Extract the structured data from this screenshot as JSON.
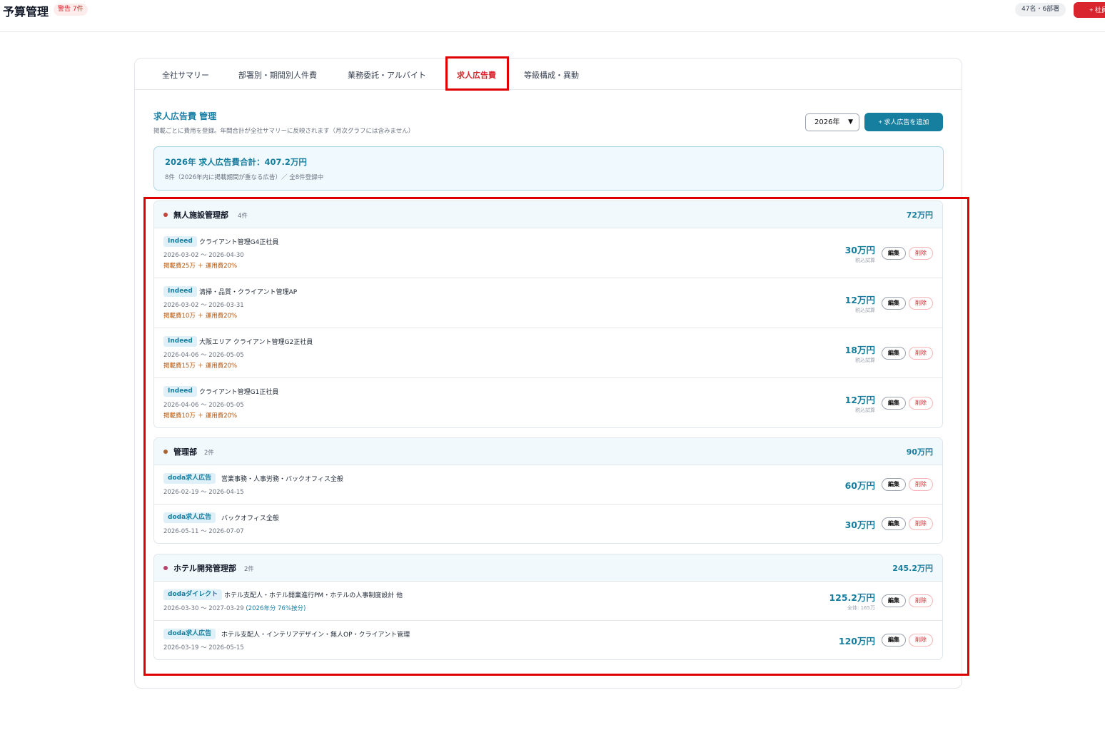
{
  "header": {
    "title": "予算管理",
    "warning_badge": "警告 7件",
    "staff_summary": "47名・6部署",
    "add_staff_label": "+ 社員"
  },
  "tabs": [
    {
      "label": "全社サマリー",
      "active": false
    },
    {
      "label": "部署別・期間別人件費",
      "active": false
    },
    {
      "label": "業務委託・アルバイト",
      "active": false
    },
    {
      "label": "求人広告費",
      "active": true
    },
    {
      "label": "等級構成・異動",
      "active": false
    }
  ],
  "section": {
    "title": "求人広告費 管理",
    "description": "掲載ごとに費用を登録。年間合計が全社サマリーに反映されます（月次グラフには含みません）",
    "year_select": "2026年",
    "add_button": "+ 求人広告を追加"
  },
  "total": {
    "title": "2026年 求人広告費合計：407.2万円",
    "subtitle": "8件（2026年内に掲載期間が重なる広告）／ 全8件登録中"
  },
  "buttons": {
    "edit": "編集",
    "delete": "削除"
  },
  "colors": {
    "accent": "#167e9e",
    "danger": "#d9262e",
    "fee_text": "#b45309"
  },
  "groups": [
    {
      "name": "無人施設管理部",
      "count": "4件",
      "total": "72万円",
      "dot_color": "#c2453a",
      "rows": [
        {
          "tag": "Indeed",
          "name": "クライアント管理G4正社員",
          "period": "2026-03-02 〜 2026-04-30",
          "fee": "掲載費25万 ＋ 運用費20%",
          "amount": "30万円",
          "note": "税込試算"
        },
        {
          "tag": "Indeed",
          "name": "清掃・品質・クライアント管理AP",
          "period": "2026-03-02 〜 2026-03-31",
          "fee": "掲載費10万 ＋ 運用費20%",
          "amount": "12万円",
          "note": "税込試算"
        },
        {
          "tag": "Indeed",
          "name": "大阪エリア クライアント管理G2正社員",
          "period": "2026-04-06 〜 2026-05-05",
          "fee": "掲載費15万 ＋ 運用費20%",
          "amount": "18万円",
          "note": "税込試算"
        },
        {
          "tag": "Indeed",
          "name": "クライアント管理G1正社員",
          "period": "2026-04-06 〜 2026-05-05",
          "fee": "掲載費10万 ＋ 運用費20%",
          "amount": "12万円",
          "note": "税込試算"
        }
      ]
    },
    {
      "name": "管理部",
      "count": "2件",
      "total": "90万円",
      "dot_color": "#a8632e",
      "rows": [
        {
          "tag": "doda求人広告",
          "name": "営業事務・人事労務・バックオフィス全般",
          "period": "2026-02-19 〜 2026-04-15",
          "amount": "60万円"
        },
        {
          "tag": "doda求人広告",
          "name": "バックオフィス全般",
          "period": "2026-05-11 〜 2026-07-07",
          "amount": "30万円"
        }
      ]
    },
    {
      "name": "ホテル開発管理部",
      "count": "2件",
      "total": "245.2万円",
      "dot_color": "#b8406a",
      "rows": [
        {
          "tag": "dodaダイレクト",
          "name": "ホテル支配人・ホテル開業進行PM・ホテルの人事制度設計 他",
          "period": "2026-03-30 〜 2027-03-29",
          "period_ratio": "(2026年分 76%按分)",
          "amount": "125.2万円",
          "note": "全体: 165万"
        },
        {
          "tag": "doda求人広告",
          "name": "ホテル支配人・インテリアデザイン・無人OP・クライアント管理",
          "period": "2026-03-19 〜 2026-05-15",
          "amount": "120万円"
        }
      ]
    }
  ]
}
